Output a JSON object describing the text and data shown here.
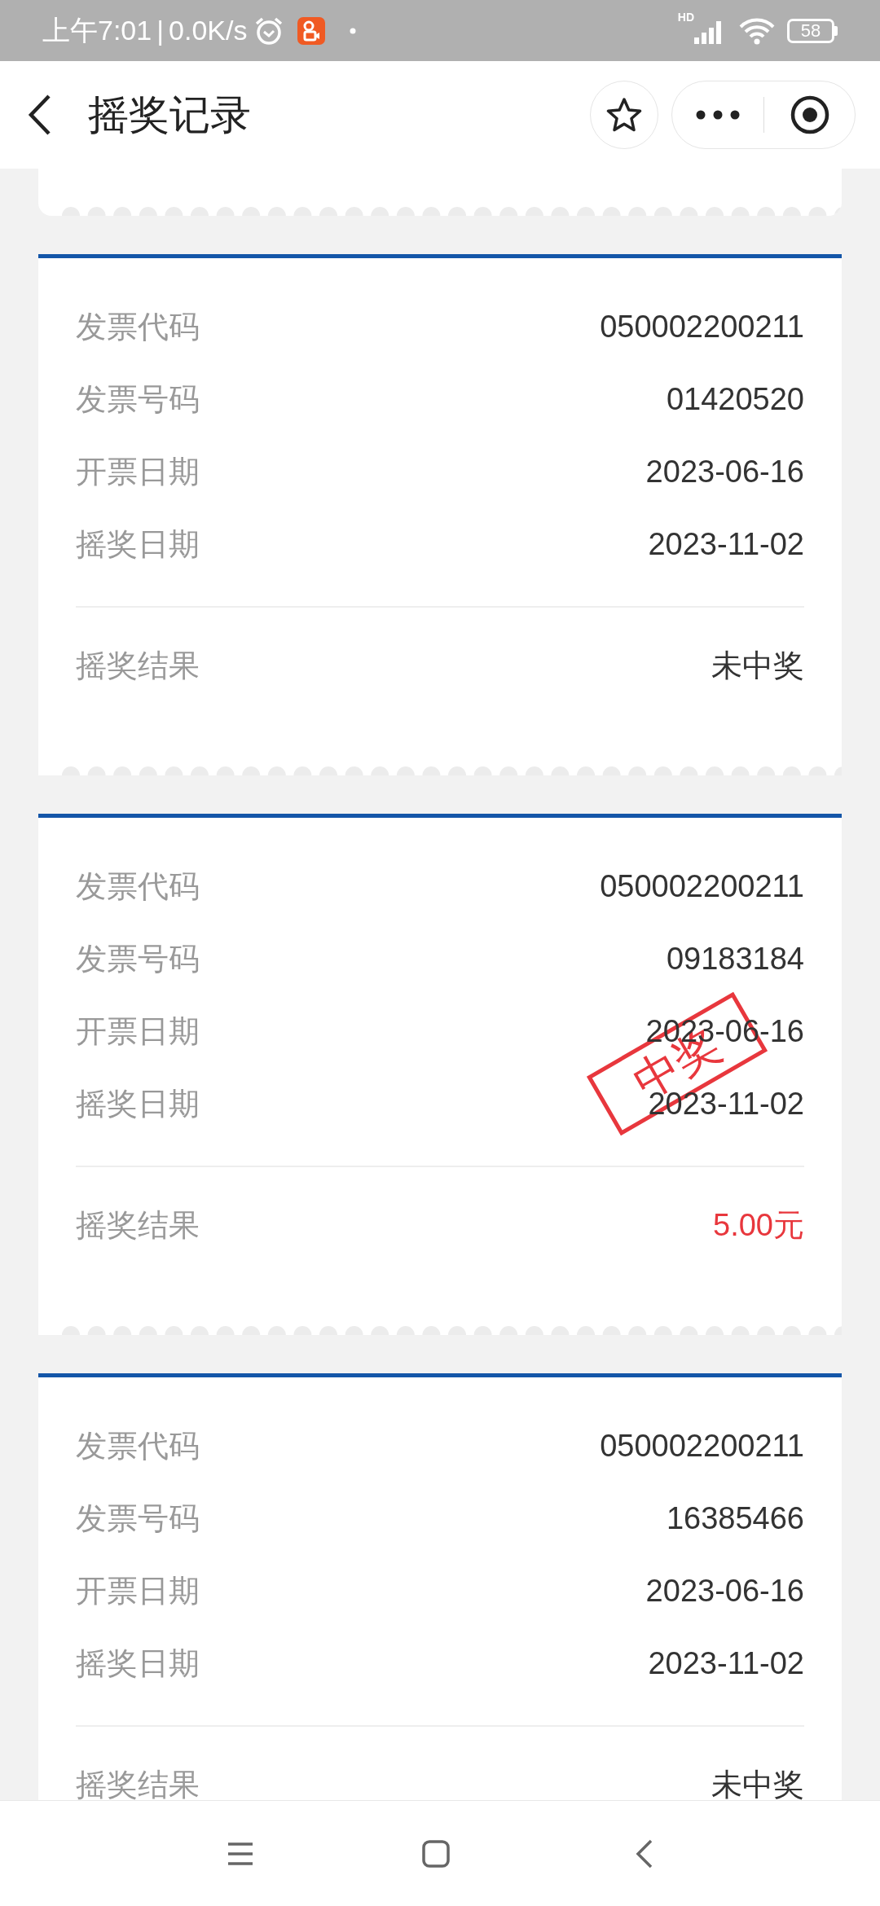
{
  "status_bar": {
    "time": "上午7:01",
    "separator": "|",
    "speed": "0.0K/s",
    "battery": "58",
    "network": "HD"
  },
  "header": {
    "title": "摇奖记录"
  },
  "records": [
    {
      "fields": [
        {
          "label": "发票代码",
          "value": "050002200211"
        },
        {
          "label": "发票号码",
          "value": "01420520"
        },
        {
          "label": "开票日期",
          "value": "2023-06-16"
        },
        {
          "label": "摇奖日期",
          "value": "2023-11-02"
        }
      ],
      "result_label": "摇奖结果",
      "result": "未中奖",
      "won": false
    },
    {
      "fields": [
        {
          "label": "发票代码",
          "value": "050002200211"
        },
        {
          "label": "发票号码",
          "value": "09183184"
        },
        {
          "label": "开票日期",
          "value": "2023-06-16"
        },
        {
          "label": "摇奖日期",
          "value": "2023-11-02"
        }
      ],
      "result_label": "摇奖结果",
      "result": "5.00元",
      "won": true,
      "stamp": "中奖"
    },
    {
      "fields": [
        {
          "label": "发票代码",
          "value": "050002200211"
        },
        {
          "label": "发票号码",
          "value": "16385466"
        },
        {
          "label": "开票日期",
          "value": "2023-06-16"
        },
        {
          "label": "摇奖日期",
          "value": "2023-11-02"
        }
      ],
      "result_label": "摇奖结果",
      "result": "未中奖",
      "won": false
    }
  ]
}
